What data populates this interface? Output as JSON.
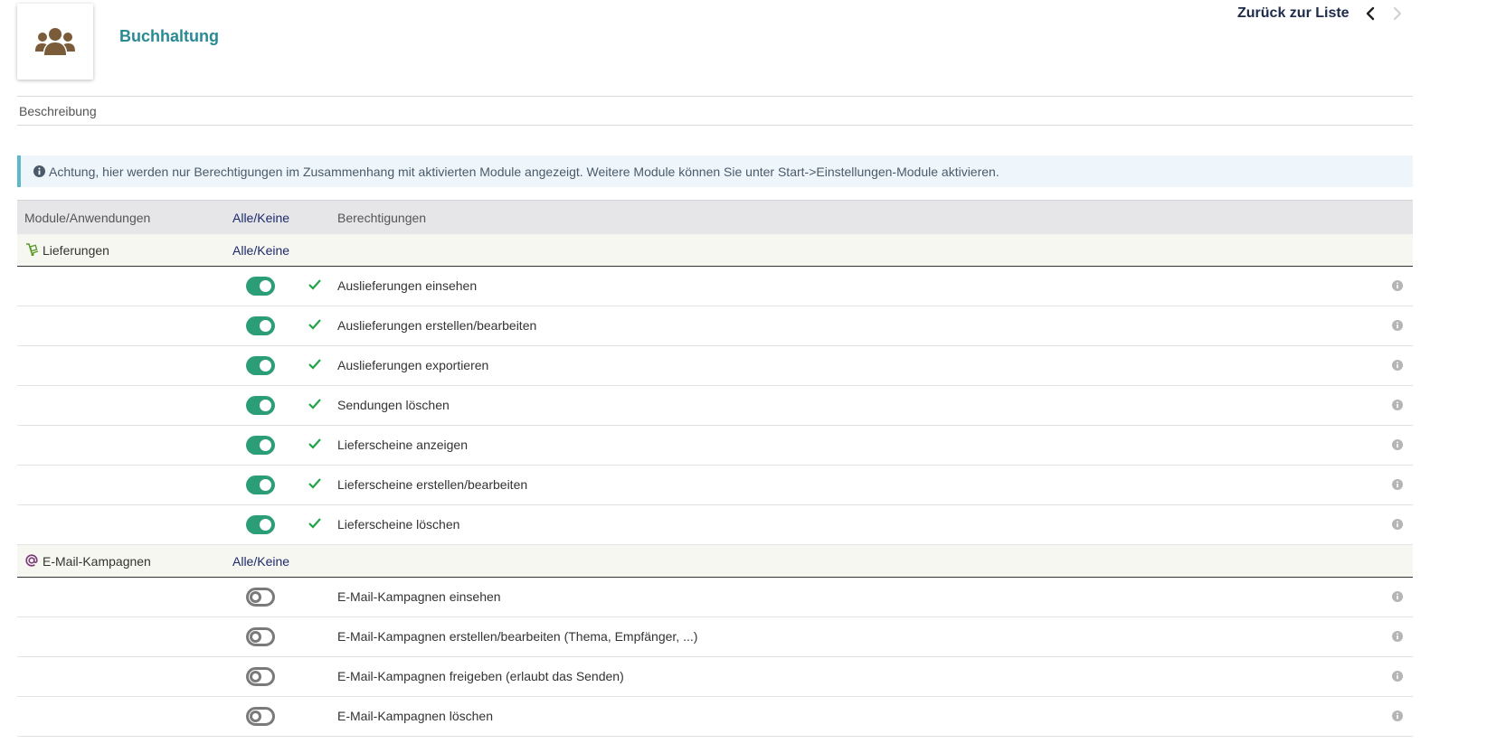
{
  "header": {
    "group_title": "Buchhaltung",
    "back_label": "Zurück zur Liste",
    "avatar_icon": "users-group-icon",
    "prev_icon": "chevron-left-icon",
    "next_icon": "chevron-right-icon"
  },
  "description": {
    "label": "Beschreibung"
  },
  "alert": {
    "icon": "info-circle-icon",
    "text": "Achtung, hier werden nur Berechtigungen im Zusammenhang mit aktivierten Module angezeigt. Weitere Module können Sie unter Start->Einstellungen-Module aktivieren."
  },
  "table": {
    "headers": {
      "modules": "Module/Anwendungen",
      "all_none": "Alle/Keine",
      "permissions": "Berechtigungen"
    },
    "sections": [
      {
        "name": "Lieferungen",
        "icon": "delivery-dolly-icon",
        "all_none": "Alle/Keine",
        "permissions": [
          {
            "label": "Auslieferungen einsehen",
            "enabled": true
          },
          {
            "label": "Auslieferungen erstellen/bearbeiten",
            "enabled": true
          },
          {
            "label": "Auslieferungen exportieren",
            "enabled": true
          },
          {
            "label": "Sendungen löschen",
            "enabled": true
          },
          {
            "label": "Lieferscheine anzeigen",
            "enabled": true
          },
          {
            "label": "Lieferscheine erstellen/bearbeiten",
            "enabled": true
          },
          {
            "label": "Lieferscheine löschen",
            "enabled": true
          }
        ]
      },
      {
        "name": "E-Mail-Kampagnen",
        "icon": "at-sign-icon",
        "all_none": "Alle/Keine",
        "permissions": [
          {
            "label": "E-Mail-Kampagnen einsehen",
            "enabled": false
          },
          {
            "label": "E-Mail-Kampagnen erstellen/bearbeiten (Thema, Empfänger, ...)",
            "enabled": false
          },
          {
            "label": "E-Mail-Kampagnen freigeben (erlaubt das Senden)",
            "enabled": false
          },
          {
            "label": "E-Mail-Kampagnen löschen",
            "enabled": false
          }
        ]
      }
    ]
  },
  "colors": {
    "accent_title": "#2a8a94",
    "toggle_on": "#2b9d77",
    "toggle_off": "#7a7a7a",
    "check": "#22a34a",
    "link": "#1d2a6b"
  }
}
